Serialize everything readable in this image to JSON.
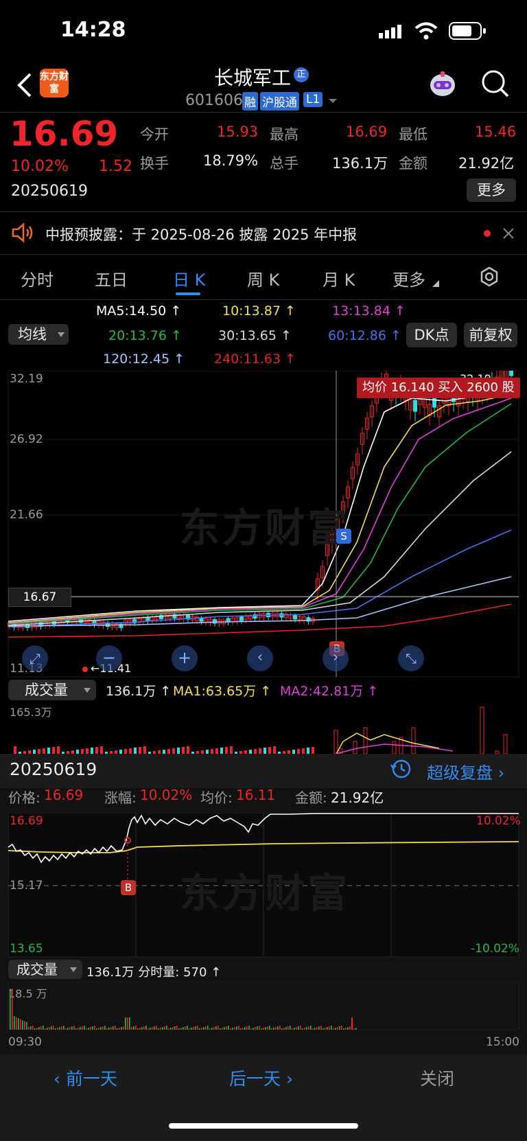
{
  "status": {
    "time": "14:28"
  },
  "header": {
    "logo_text": "东方财富",
    "title": "长城军工",
    "title_badge": "正",
    "code": "601606",
    "tags": [
      "融",
      "沪股通",
      "L1"
    ]
  },
  "quote": {
    "price": "16.69",
    "change_pct": "10.02%",
    "change": "1.52",
    "date": "20250619",
    "stats": [
      {
        "label": "今开",
        "value": "15.93"
      },
      {
        "label": "最高",
        "value": "16.69"
      },
      {
        "label": "最低",
        "value": "15.46"
      },
      {
        "label": "换手",
        "value": "18.79%"
      },
      {
        "label": "总手",
        "value": "136.1万"
      },
      {
        "label": "金额",
        "value": "21.92亿"
      }
    ],
    "more_label": "更多"
  },
  "notice": {
    "text": "中报预披露：于 2025-08-26 披露 2025 年中报"
  },
  "tabs": [
    "分时",
    "五日",
    "日 K",
    "周 K",
    "月 K",
    "更多"
  ],
  "active_tab": 2,
  "ma_legend": {
    "selector": "均线",
    "items": [
      {
        "text": "MA5:14.50 ↑",
        "color": "#ffffff"
      },
      {
        "text": "10:13.87 ↑",
        "color": "#f5e04a"
      },
      {
        "text": "13:13.84 ↑",
        "color": "#e040d8"
      },
      {
        "text": "20:13.76 ↑",
        "color": "#22b84a"
      },
      {
        "text": "30:13.65 ↑",
        "color": "#d8d8d8"
      },
      {
        "text": "60:12.86 ↑",
        "color": "#4a6ff0"
      },
      {
        "text": "120:12.45 ↑",
        "color": "#a9c2ff"
      },
      {
        "text": "240:11.63 ↑",
        "color": "#e4222a"
      }
    ],
    "dk_button": "DK点",
    "adjust_button": "前复权"
  },
  "kline": {
    "y_labels": [
      "32.19",
      "26.92",
      "21.66",
      "16.67",
      "11.13"
    ],
    "top_marker": "32.19",
    "low_marker": "11.41",
    "tooltip": "均价 16.140 买入 2600 股",
    "signal_s": "S",
    "signal_b": "B",
    "watermark": "东方财富"
  },
  "volume": {
    "selector": "成交量",
    "total": "136.1万 ↑",
    "ma1": "MA1:63.65万 ↑",
    "ma2": "MA2:42.81万 ↑",
    "axis_max": "165.3万"
  },
  "replay": {
    "date": "20250619",
    "super_replay": "超级复盘",
    "price_label": "价格:",
    "price": "16.69",
    "chg_label": "涨幅:",
    "chg": "10.02%",
    "avg_label": "均价:",
    "avg": "16.11",
    "amount_label": "金额:",
    "amount": "21.92亿",
    "y_top": "16.69",
    "y_mid": "15.17",
    "y_bot": "13.65",
    "pct_top": "10.02%",
    "pct_bot": "-10.02%",
    "signal_b": "B",
    "vol_selector": "成交量",
    "vol_text": "136.1万 分时量: 570 ↑",
    "vol_max": "18.5 万",
    "time_start": "09:30",
    "time_end": "15:00"
  },
  "footer": {
    "prev": "前一天",
    "next": "后一天",
    "close": "关闭"
  },
  "colors": {
    "up": "#f0242a",
    "down": "#2ce0e0",
    "accent": "#2f8cf0",
    "bg": "#000000"
  }
}
